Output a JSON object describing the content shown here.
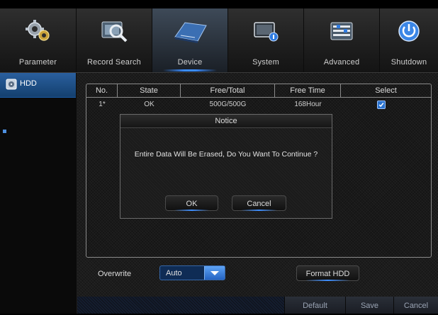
{
  "top_tabs": [
    {
      "label": "Parameter",
      "icon": "gears-icon"
    },
    {
      "label": "Record Search",
      "icon": "magnifier-icon"
    },
    {
      "label": "Device",
      "icon": "hard-drive-icon"
    },
    {
      "label": "System",
      "icon": "monitor-info-icon"
    },
    {
      "label": "Advanced",
      "icon": "sliders-icon"
    },
    {
      "label": "Shutdown",
      "icon": "power-icon"
    }
  ],
  "active_tab": "Device",
  "sidebar": {
    "items": [
      {
        "label": "HDD",
        "icon": "hdd-icon"
      }
    ]
  },
  "hdd_table": {
    "headers": [
      "No.",
      "State",
      "Free/Total",
      "Free Time",
      "Select"
    ],
    "rows": [
      {
        "no": "1*",
        "state": "OK",
        "free_total": "500G/500G",
        "free_time": "168Hour",
        "selected": true
      }
    ]
  },
  "overwrite": {
    "label": "Overwrite",
    "value": "Auto"
  },
  "format_button": "Format HDD",
  "bottom_buttons": {
    "default": "Default",
    "save": "Save",
    "cancel": "Cancel"
  },
  "dialog": {
    "title": "Notice",
    "message": "Entire Data Will Be Erased, Do You Want To Continue ?",
    "ok": "OK",
    "cancel": "Cancel"
  },
  "colors": {
    "accent": "#3a8cff",
    "sidebar_selected": "#2a5f9e",
    "checkbox": "#2a73d0"
  }
}
